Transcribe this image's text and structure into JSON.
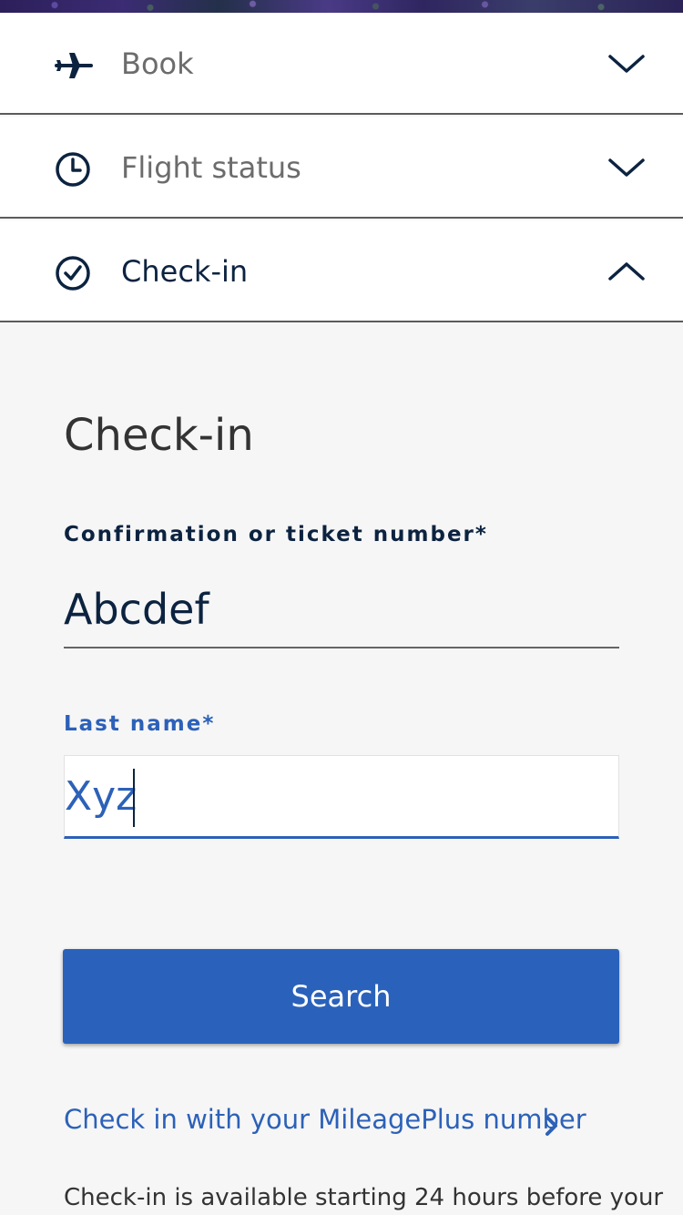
{
  "accordion": {
    "book": {
      "label": "Book",
      "icon": "airplane-icon",
      "state": "collapsed"
    },
    "flight_status": {
      "label": "Flight status",
      "icon": "clock-icon",
      "state": "collapsed"
    },
    "check_in": {
      "label": "Check-in",
      "icon": "check-circle-icon",
      "state": "expanded"
    }
  },
  "checkin_panel": {
    "title": "Check-in",
    "confirmation": {
      "label": "Confirmation or ticket number*",
      "value": "Abcdef"
    },
    "last_name": {
      "label": "Last name*",
      "value": "Xyz"
    },
    "search_label": "Search",
    "mileageplus_link": "Check in with your MileagePlus number",
    "info_text": "Check-in is available starting 24 hours before your"
  },
  "colors": {
    "navy": "#0c2340",
    "accent_blue": "#2a62bb",
    "panel_background": "#f6f6f6",
    "muted_text": "#6c6c6c"
  }
}
